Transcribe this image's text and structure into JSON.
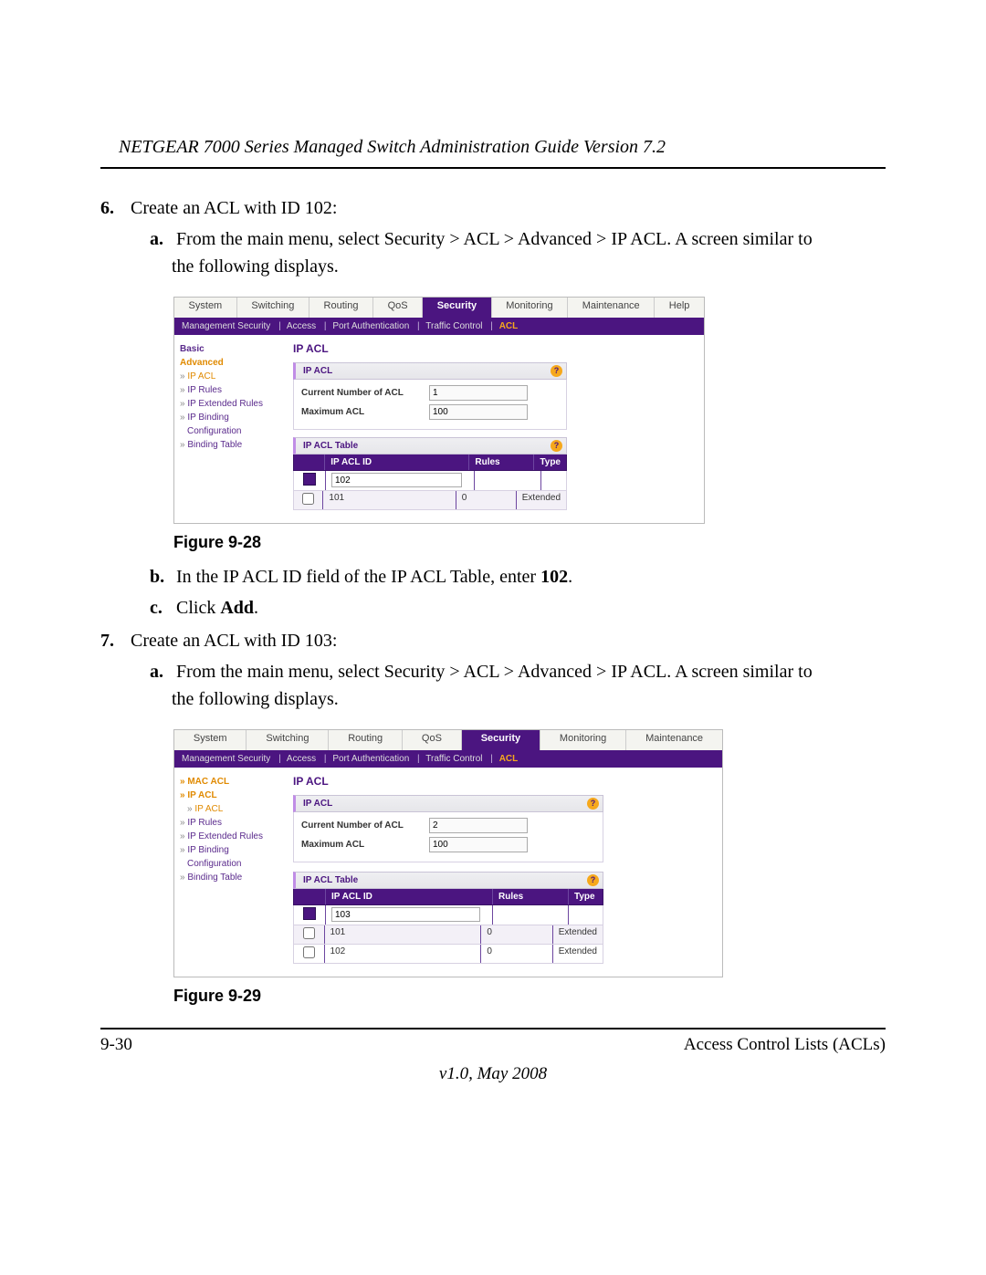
{
  "header_title": "NETGEAR 7000 Series Managed Switch Administration Guide Version 7.2",
  "steps": {
    "s6": {
      "num": "6.",
      "text": "Create an ACL with ID 102:",
      "a_letter": "a.",
      "a_text_1": "From the main menu, select Security > ACL > Advanced > IP ACL. A screen similar to",
      "a_text_2": "the following displays.",
      "b_letter": "b.",
      "b_text_1": "In the IP ACL ID field of the IP ACL Table, enter ",
      "b_bold": "102",
      "b_text_2": ".",
      "c_letter": "c.",
      "c_text_1": "Click ",
      "c_bold": "Add",
      "c_text_2": "."
    },
    "s7": {
      "num": "7.",
      "text": "Create an ACL with ID 103:",
      "a_letter": "a.",
      "a_text_1": "From the main menu, select Security > ACL > Advanced > IP ACL. A screen similar to",
      "a_text_2": "the following displays."
    }
  },
  "figcap1": "Figure 9-28",
  "figcap2": "Figure 9-29",
  "ui_shared": {
    "tabs": {
      "system": "System",
      "switching": "Switching",
      "routing": "Routing",
      "qos": "QoS",
      "security": "Security",
      "monitoring": "Monitoring",
      "maintenance": "Maintenance",
      "help": "Help"
    },
    "subnav": {
      "mgmt": "Management Security",
      "access": "Access",
      "portauth": "Port Authentication",
      "traffic": "Traffic Control",
      "acl": "ACL",
      "sep": "|"
    },
    "content": {
      "title": "IP ACL",
      "panel1_title": "IP ACL",
      "cur_label": "Current Number of ACL",
      "max_label": "Maximum ACL",
      "max_value": "100",
      "panel2_title": "IP ACL Table",
      "col_id": "IP ACL ID",
      "col_rules": "Rules",
      "col_type": "Type",
      "qmark": "?"
    },
    "sidebar_common": {
      "chev": "»",
      "ip_acl": "IP ACL",
      "ip_rules": "IP Rules",
      "ip_ext": "IP Extended Rules",
      "ip_bind": "IP Binding",
      "config": "Configuration",
      "bind_tbl": "Binding Table"
    }
  },
  "ui1": {
    "sidebar": {
      "basic": "Basic",
      "advanced": "Advanced"
    },
    "cur_value": "1",
    "input_value": "102",
    "rows": [
      {
        "id": "101",
        "rules": "0",
        "type": "Extended"
      }
    ]
  },
  "ui2": {
    "sidebar": {
      "mac_acl": "MAC ACL",
      "ip_acl_cat": "IP ACL"
    },
    "cur_value": "2",
    "input_value": "103",
    "rows": [
      {
        "id": "101",
        "rules": "0",
        "type": "Extended"
      },
      {
        "id": "102",
        "rules": "0",
        "type": "Extended"
      }
    ]
  },
  "footer": {
    "pagenum": "9-30",
    "section": "Access Control Lists (ACLs)",
    "version": "v1.0, May 2008"
  }
}
